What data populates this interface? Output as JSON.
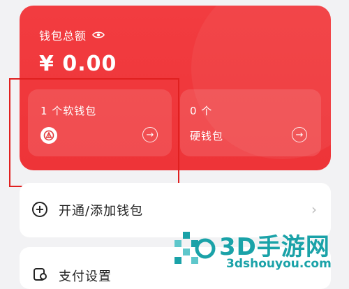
{
  "wallet_card": {
    "total_label": "钱包总额",
    "amount": "¥ 0.00",
    "soft_wallet": {
      "title": "1 个软钱包"
    },
    "hard_wallet": {
      "count": "0 个",
      "label": "硬钱包"
    }
  },
  "menu": {
    "open_add_label": "开通/添加钱包",
    "pay_settings_label": "支付设置"
  },
  "watermark": {
    "title": "3D手游网",
    "url": "3dshouyou.com"
  },
  "colors": {
    "card_red": "#f23c40",
    "highlight_border": "#e02020",
    "watermark_teal": "#1aa2a8"
  },
  "icons": [
    "eye-icon",
    "bank-logo-icon",
    "arrow-right-circle-icon",
    "plus-circle-icon",
    "chevron-right-icon",
    "pay-settings-icon"
  ]
}
